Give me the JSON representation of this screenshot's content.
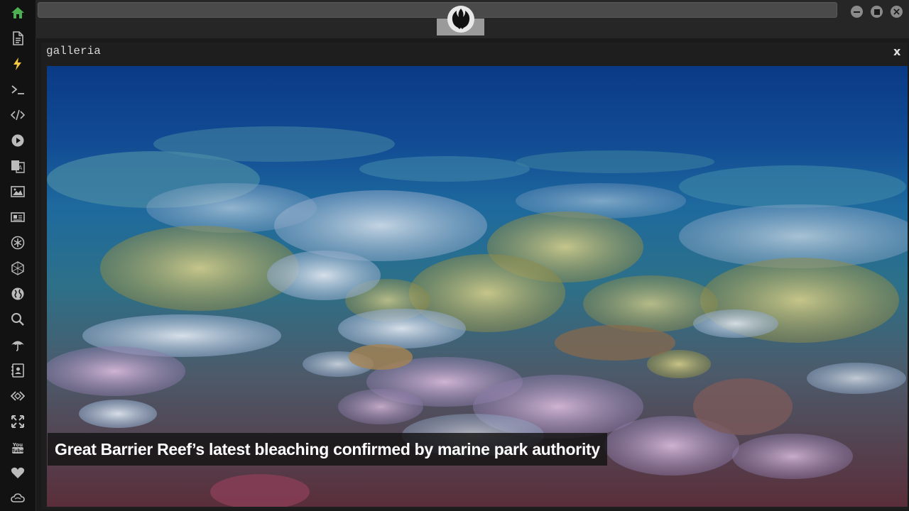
{
  "sidebar": {
    "items": [
      {
        "icon": "home-icon",
        "active_color": "#4caf50"
      },
      {
        "icon": "document-icon"
      },
      {
        "icon": "lightning-icon",
        "active_color": "#f5c842"
      },
      {
        "icon": "terminal-icon"
      },
      {
        "icon": "code-icon"
      },
      {
        "icon": "play-icon"
      },
      {
        "icon": "translate-icon"
      },
      {
        "icon": "image-icon"
      },
      {
        "icon": "news-icon"
      },
      {
        "icon": "asterisk-icon"
      },
      {
        "icon": "hexagon-icon"
      },
      {
        "icon": "globe-icon"
      },
      {
        "icon": "search-icon"
      },
      {
        "icon": "umbrella-icon"
      },
      {
        "icon": "contacts-icon"
      },
      {
        "icon": "embed-icon"
      },
      {
        "icon": "expand-icon"
      },
      {
        "icon": "youtube-icon"
      },
      {
        "icon": "heart-icon"
      },
      {
        "icon": "cloud-icon"
      }
    ]
  },
  "window": {
    "logo": "rebel-alliance-logo",
    "controls": [
      "minimize-icon",
      "maximize-icon",
      "close-icon"
    ]
  },
  "panel": {
    "title": "galleria",
    "close_label": "x"
  },
  "gallery": {
    "caption": "Great Barrier Reef’s latest bleaching confirmed by marine park authority"
  },
  "colors": {
    "sidebar_bg": "#121212",
    "topbar_bg": "#262626",
    "panel_bg": "#1e1e1e",
    "home_green": "#4caf50",
    "lightning_yellow": "#f5c842"
  }
}
